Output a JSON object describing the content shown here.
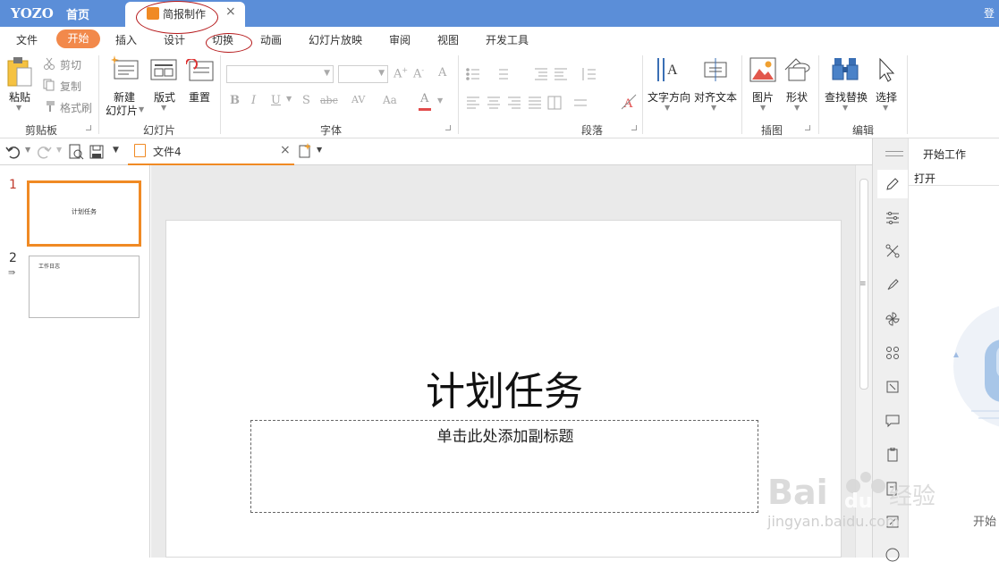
{
  "titlebar": {
    "logo": "YOZO",
    "home": "首页",
    "doc_tab": "简报制作",
    "doc_tab_close": "×",
    "login": "登"
  },
  "menu": {
    "items": [
      "文件",
      "开始",
      "插入",
      "设计",
      "切换",
      "动画",
      "幻灯片放映",
      "审阅",
      "视图",
      "开发工具"
    ],
    "active": "开始"
  },
  "ribbon": {
    "clipboard": {
      "paste": "粘贴",
      "cut": "剪切",
      "copy": "复制",
      "format_painter": "格式刷",
      "group": "剪贴板"
    },
    "slides": {
      "new_slide_line1": "新建",
      "new_slide_line2": "幻灯片",
      "layout": "版式",
      "reset": "重置",
      "group": "幻灯片"
    },
    "font": {
      "group": "字体",
      "font_name": "",
      "font_size": ""
    },
    "paragraph": {
      "group": "段落"
    },
    "text_direction": "文字方向",
    "align_text": "对齐文本",
    "illustrations": {
      "picture": "图片",
      "shape": "形状",
      "group": "插图"
    },
    "editing": {
      "find_replace": "查找替换",
      "select": "选择",
      "group": "编辑"
    }
  },
  "quickbar": {
    "file_tab": "文件4",
    "file_tab_close": "×"
  },
  "thumbnails": [
    {
      "num": "1",
      "text": "计划任务",
      "selected": true
    },
    {
      "num": "2",
      "text": "工作日志",
      "selected": false
    }
  ],
  "slide": {
    "title": "计划任务",
    "subtitle_placeholder": "单击此处添加副标题"
  },
  "taskpane": {
    "title": "开始工作",
    "open": "打开",
    "start": "开始"
  },
  "watermark": {
    "text": "jingyan.baidu.com"
  },
  "colors": {
    "titlebar": "#5b8ed8",
    "accent": "#f08a24",
    "active_tab": "#f2894b",
    "annotation": "#b5181a"
  }
}
